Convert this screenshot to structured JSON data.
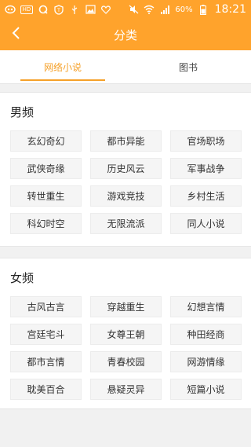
{
  "status_bar": {
    "battery_text": "60%",
    "time": "18:21",
    "left_icons": [
      "app-notification-icon",
      "hd-icon",
      "qq-icon",
      "shield-icon",
      "usb-icon",
      "image-icon",
      "heart-icon"
    ],
    "right_icons": [
      "mute-icon",
      "wifi-icon",
      "signal-icon",
      "battery-icon"
    ]
  },
  "header": {
    "title": "分类"
  },
  "tabs": [
    {
      "label": "网络小说",
      "active": true
    },
    {
      "label": "图书",
      "active": false
    }
  ],
  "male": {
    "title": "男频",
    "items": [
      "玄幻奇幻",
      "都市异能",
      "官场职场",
      "武侠奇缘",
      "历史风云",
      "军事战争",
      "转世重生",
      "游戏竞技",
      "乡村生活",
      "科幻时空",
      "无限流派",
      "同人小说"
    ]
  },
  "female": {
    "title": "女频",
    "items": [
      "古风古言",
      "穿越重生",
      "幻想言情",
      "宫廷宅斗",
      "女尊王朝",
      "种田经商",
      "都市言情",
      "青春校园",
      "网游情缘",
      "耽美百合",
      "悬疑灵异",
      "短篇小说"
    ]
  },
  "colors": {
    "accent": "#ffa32c",
    "tab_active": "#f5a12a"
  }
}
